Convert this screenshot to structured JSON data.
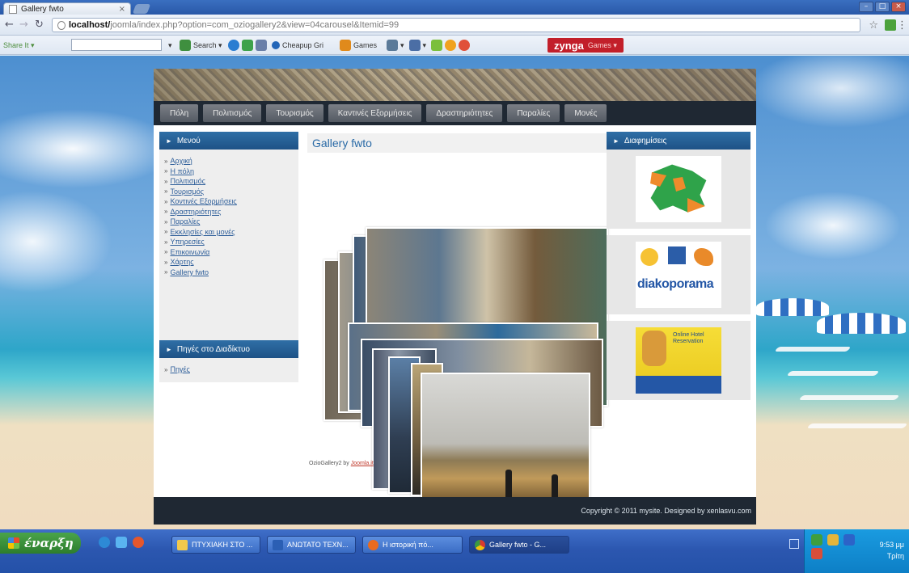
{
  "browser": {
    "tab_title": "Gallery fwto",
    "tab_close": "×",
    "url_host": "localhost/",
    "url_path": "joomla/index.php?option=com_oziogallery2&view=04carousel&Itemid=99",
    "toolbar": {
      "share": "Share It ▾",
      "search_label": "Search ▾",
      "cheap_label": "Cheapup Gri",
      "games_label": "Games",
      "zynga_label": "zynga",
      "zynga_sub": "Games ▾"
    }
  },
  "site": {
    "nav": [
      "Πόλη",
      "Πολιτισμός",
      "Τουρισμός",
      "Καντινές Εξορμήσεις",
      "Δραστηριότητες",
      "Παραλίες",
      "Μονές"
    ],
    "left_menu": {
      "title": "Μενού",
      "items": [
        "Αρχική",
        "Η πόλη",
        "Πολιτισμός",
        "Τουρισμός",
        "Κοντινές Εξορμήσεις",
        "Δραστηριότητες",
        "Παραλίες",
        "Εκκλησίες και μονές",
        "Υπηρεσίες",
        "Επικοινωνία",
        "Χάρτης",
        "Gallery fwto"
      ]
    },
    "sources": {
      "title": "Πηγές στο Διαδίκτυο",
      "items": [
        "Πηγές"
      ]
    },
    "main": {
      "title": "Gallery fwto",
      "credit_prefix": "OzioGallery2 by ",
      "credit_link": "Joomla.it"
    },
    "right": {
      "title": "Διαφημίσεις",
      "ad2_text": "diakoporama",
      "ad3_text": "Online Hotel Reservation"
    },
    "footer": "Copyright © 2011 mysite. Designed by xenlasvu.com"
  },
  "taskbar": {
    "start_label": "έναρξη",
    "tasks": [
      "ΠΤΥΧΙΑΚΗ ΣΤΟ ...",
      "ΑΝΩΤΑΤΟ ΤΕΧΝ...",
      "Η ιστορική πό...",
      "Gallery fwto - G..."
    ],
    "time": "9:53 μμ",
    "day": "Τρίτη"
  }
}
